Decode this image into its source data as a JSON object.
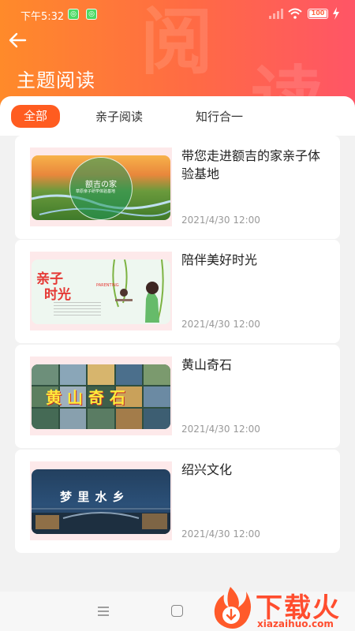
{
  "status": {
    "time": "下午5:32",
    "battery": "100"
  },
  "header": {
    "title": "主题阅读",
    "watermark_1": "阅",
    "watermark_2": "读"
  },
  "tabs": [
    {
      "label": "全部",
      "active": true
    },
    {
      "label": "亲子阅读",
      "active": false
    },
    {
      "label": "知行合一",
      "active": false
    }
  ],
  "articles": [
    {
      "title": "带您走进额吉的家亲子体验基地",
      "date": "2021/4/30 12:00",
      "image_text": "额吉の家",
      "image_subtext": "草原亲子研学体验基地"
    },
    {
      "title": "陪伴美好时光",
      "date": "2021/4/30 12:00",
      "image_text_1": "亲子",
      "image_text_2": "时光",
      "image_subtext": "PARENTING"
    },
    {
      "title": "黄山奇石",
      "date": "2021/4/30 12:00",
      "image_text": "黄 山 奇 石"
    },
    {
      "title": "绍兴文化",
      "date": "2021/4/30 12:00",
      "image_text": "梦 里 水 乡"
    }
  ],
  "watermark_logo": {
    "text": "下载火",
    "sub": "xiazaihuo.com"
  },
  "colors": {
    "accent": "#ff5c20",
    "header_start": "#ff8a2a",
    "header_end": "#ff5566"
  }
}
